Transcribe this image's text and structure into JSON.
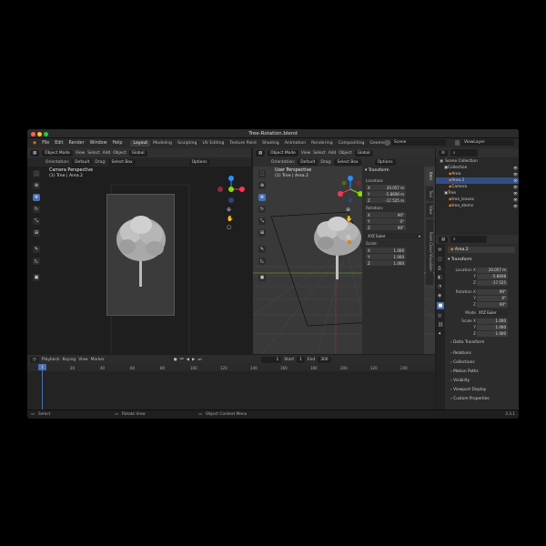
{
  "window": {
    "title": "Tree-Rotation.blend"
  },
  "menu": [
    "File",
    "Edit",
    "Render",
    "Window",
    "Help"
  ],
  "workspaces": [
    "Layout",
    "Modeling",
    "Sculpting",
    "UV Editing",
    "Texture Paint",
    "Shading",
    "Animation",
    "Rendering",
    "Compositing",
    "Geometry Nodes"
  ],
  "scene": "Scene",
  "view_layer": "ViewLayer",
  "left_viewport": {
    "mode": "Object Mode",
    "menus": [
      "View",
      "Select",
      "Add",
      "Object"
    ],
    "transform_orientation": "Global",
    "orientation_label": "Orientation:",
    "orientation_value": "Default",
    "drag_label": "Drag:",
    "drag_value": "Select Box",
    "options": "Options",
    "overlay_title": "Camera Perspective",
    "overlay_sub": "(1) Tree | Area.2"
  },
  "right_viewport": {
    "mode": "Object Mode",
    "menus": [
      "View",
      "Select",
      "Add",
      "Object"
    ],
    "transform_orientation": "Global",
    "orientation_label": "Orientation:",
    "orientation_value": "Default",
    "drag_label": "Drag:",
    "drag_value": "Select Box",
    "options": "Options",
    "overlay_title": "User Perspective",
    "overlay_sub": "(1) Tree | Area.2"
  },
  "npanel": {
    "title": "Transform",
    "location_label": "Location:",
    "location": [
      {
        "axis": "X",
        "value": "20.057 m"
      },
      {
        "axis": "Y",
        "value": "-5.8608 m"
      },
      {
        "axis": "Z",
        "value": "-17.525 m"
      }
    ],
    "rotation_label": "Rotation:",
    "rotation": [
      {
        "axis": "X",
        "value": "90°"
      },
      {
        "axis": "Y",
        "value": "0°"
      },
      {
        "axis": "Z",
        "value": "90°"
      }
    ],
    "rotation_mode": "XYZ Euler",
    "scale_label": "Scale:",
    "scale": [
      {
        "axis": "X",
        "value": "1.000"
      },
      {
        "axis": "Y",
        "value": "1.000"
      },
      {
        "axis": "Z",
        "value": "1.000"
      }
    ],
    "tabs": [
      "Item",
      "Tool",
      "View",
      "Point Cloud Visualizer"
    ]
  },
  "timeline": {
    "menus": [
      "Playback",
      "Keying",
      "View",
      "Marker"
    ],
    "current_frame": "1",
    "start_label": "Start",
    "start": "1",
    "end_label": "End",
    "end": "300",
    "ticks": [
      "1",
      "20",
      "40",
      "60",
      "80",
      "100",
      "120",
      "140",
      "160",
      "180",
      "200",
      "220",
      "240"
    ]
  },
  "outliner": {
    "title": "Scene Collection",
    "items": [
      {
        "label": "Collection",
        "indent": 1
      },
      {
        "label": "Area",
        "indent": 2
      },
      {
        "label": "Area.2",
        "indent": 2,
        "selected": true
      },
      {
        "label": "Camera",
        "indent": 2
      },
      {
        "label": "Tree",
        "indent": 1
      },
      {
        "label": "tree_leaves",
        "indent": 2
      },
      {
        "label": "tree_stems",
        "indent": 2
      }
    ]
  },
  "properties": {
    "object_name": "Area.2",
    "transform_title": "Transform",
    "location_label": "Location X",
    "location": [
      "20.057 m",
      "-5.8608",
      "-17.525"
    ],
    "rotation_label": "Rotation X",
    "rotation": [
      "90°",
      "0°",
      "90°"
    ],
    "axis_y": "Y",
    "axis_z": "Z",
    "mode_label": "Mode",
    "mode": "XYZ Euler",
    "scale_label": "Scale X",
    "scale": [
      "1.000",
      "1.000",
      "1.000"
    ],
    "delta_transform": "Delta Transform",
    "sections": [
      "Relations",
      "Collections",
      "Motion Paths",
      "Visibility",
      "Viewport Display",
      "Custom Properties"
    ]
  },
  "status": {
    "select": "Select",
    "rotate": "Rotate View",
    "context": "Object Context Menu",
    "version": "3.3.1"
  },
  "colors": {
    "accent": "#4772b3",
    "x_axis": "#ff3352",
    "y_axis": "#8bdc00",
    "z_axis": "#2890ff",
    "header": "#303030",
    "panel": "#2c2c2c"
  }
}
